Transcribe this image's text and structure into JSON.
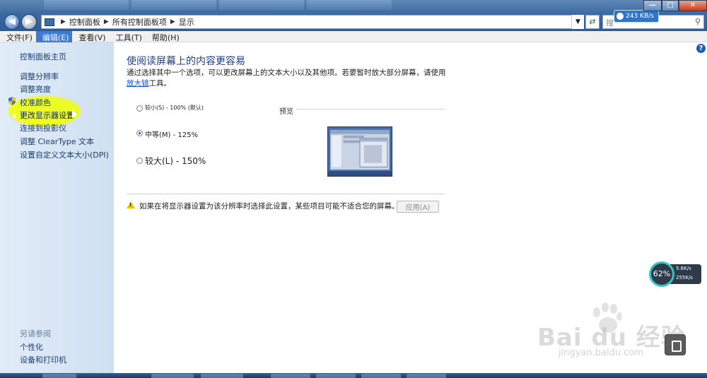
{
  "window": {
    "breadcrumb": [
      "控制面板",
      "所有控制面板项",
      "显示"
    ],
    "search_placeholder": "搜",
    "download_speed": "243 KB/s"
  },
  "menubar": {
    "items": [
      "文件(F)",
      "编辑(E)",
      "查看(V)",
      "工具(T)",
      "帮助(H)"
    ],
    "active_index": 1
  },
  "sidebar": {
    "home": "控制面板主页",
    "items": [
      "调整分辨率",
      "调整亮度",
      "校准颜色",
      "更改显示器设置",
      "连接到投影仪",
      "调整 ClearType 文本",
      "设置自定义文本大小(DPI)"
    ],
    "current_index": 3,
    "see_also_title": "另请参阅",
    "see_also": [
      "个性化",
      "设备和打印机"
    ]
  },
  "main": {
    "title": "使阅读屏幕上的内容更容易",
    "desc_before_link": "通过选择其中一个选项，可以更改屏幕上的文本大小以及其他项。若要暂时放大部分屏幕，请使用",
    "desc_link": "放大镜",
    "desc_after_link": "工具。",
    "options": [
      {
        "label": "较小(S) - 100% (默认)",
        "selected": false
      },
      {
        "label": "中等(M) - 125%",
        "selected": true
      },
      {
        "label": "较大(L) - 150%",
        "selected": false
      }
    ],
    "preview_label": "预览",
    "warning_text": "如果在将显示器设置为该分辨率时选择此设置，某些项目可能不适合您的屏幕。",
    "apply_label": "应用(A)"
  },
  "net_widget": {
    "percent": "62%",
    "upload": "5.6K/s",
    "download": "255K/s"
  },
  "watermark": {
    "logo": "Bai du 经验",
    "url": "jingyan.baidu.com"
  }
}
